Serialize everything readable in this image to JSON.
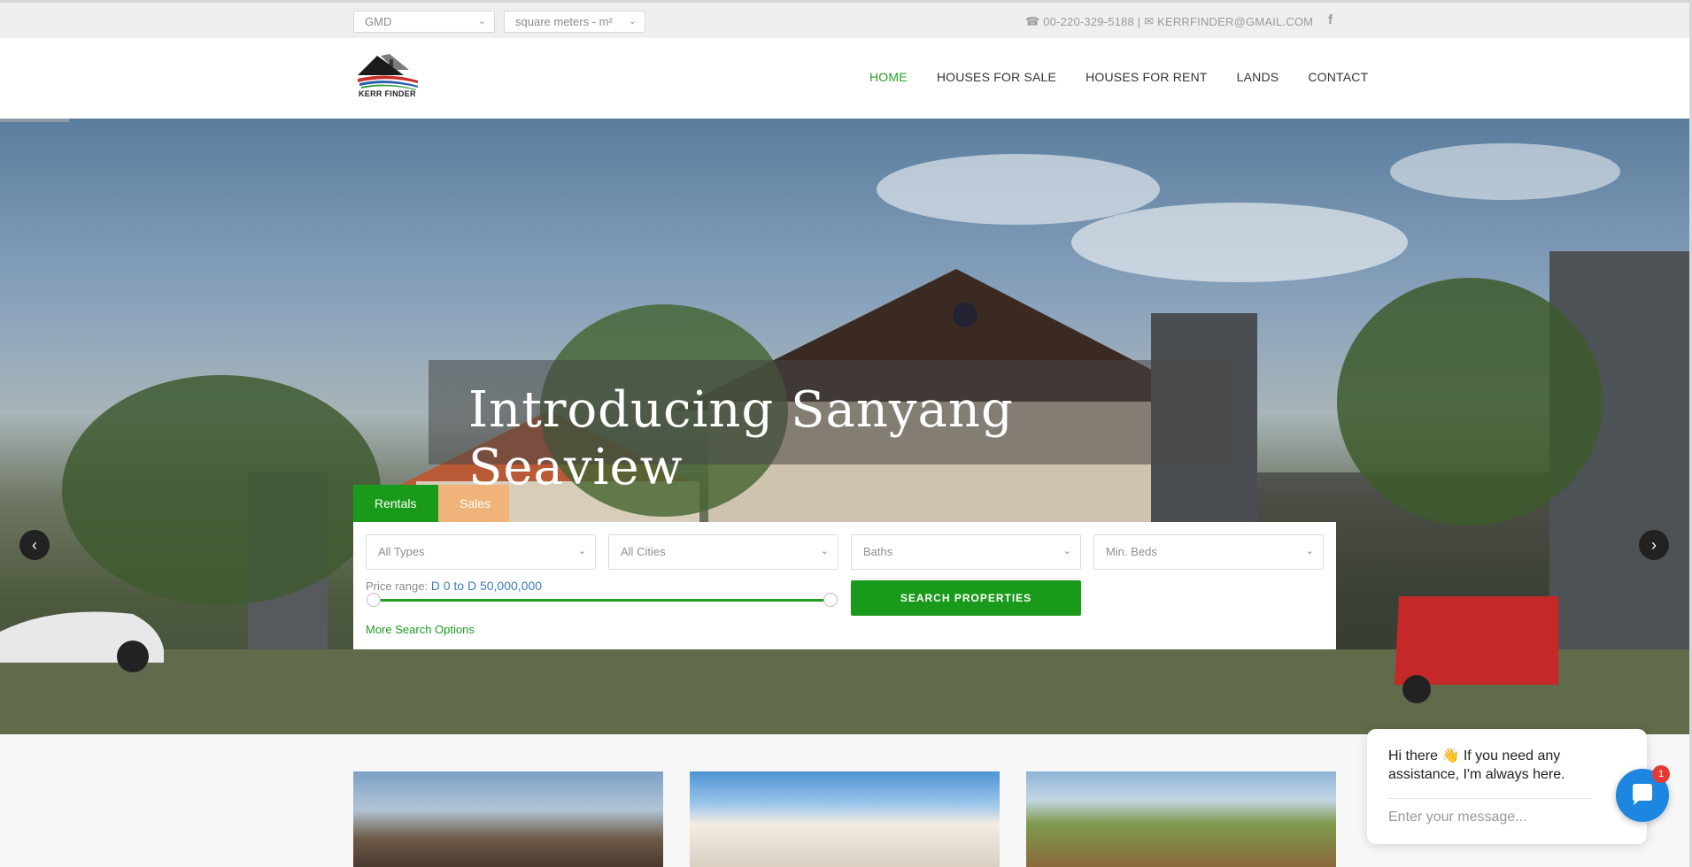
{
  "topbar": {
    "currency": "GMD",
    "unit": "square meters - m²",
    "phone": "00-220-329-5188",
    "separator": "|",
    "email": "KERRFINDER@GMAIL.COM",
    "facebook_glyph": "f"
  },
  "header": {
    "brand": "KERR FINDER",
    "nav": [
      "HOME",
      "HOUSES FOR SALE",
      "HOUSES FOR RENT",
      "LANDS",
      "CONTACT"
    ]
  },
  "hero": {
    "title": "Introducing Sanyang Seaview",
    "prev_glyph": "‹",
    "next_glyph": "›"
  },
  "search": {
    "tabs": {
      "rentals": "Rentals",
      "sales": "Sales"
    },
    "types_placeholder": "All Types",
    "cities_placeholder": "All Cities",
    "baths_placeholder": "Baths",
    "beds_placeholder": "Min. Beds",
    "price_label": "Price range:",
    "price_value": "D 0 to D 50,000,000",
    "search_button": "SEARCH PROPERTIES",
    "more_options": "More Search Options"
  },
  "chat": {
    "message": "Hi there 👋 If you need any assistance, I'm always here.",
    "input_placeholder": "Enter your message...",
    "badge_count": "1"
  },
  "colors": {
    "accent_green": "#1a9a1a",
    "sales_tab": "#f0b37a",
    "chat_blue": "#1c86e0"
  }
}
